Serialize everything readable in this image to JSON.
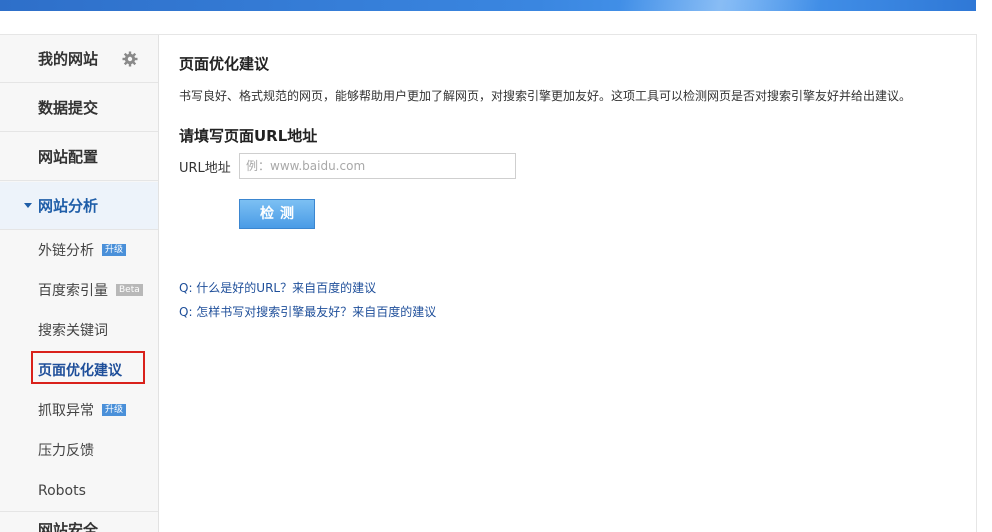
{
  "sidebar": {
    "top_items": [
      {
        "label": "我的网站"
      },
      {
        "label": "数据提交"
      },
      {
        "label": "网站配置"
      },
      {
        "label": "网站分析"
      }
    ],
    "sub_items": [
      {
        "label": "外链分析",
        "badge": "升级"
      },
      {
        "label": "百度索引量",
        "badge": "Beta"
      },
      {
        "label": "搜索关键词"
      },
      {
        "label": "页面优化建议"
      },
      {
        "label": "抓取异常",
        "badge": "升级"
      },
      {
        "label": "压力反馈"
      },
      {
        "label": "Robots"
      }
    ],
    "bottom_label": "网站安全"
  },
  "main": {
    "title": "页面优化建议",
    "description": "书写良好、格式规范的网页，能够帮助用户更加了解网页，对搜索引擎更加友好。这项工具可以检测网页是否对搜索引擎友好并给出建议。",
    "form_title": "请填写页面URL地址",
    "url_label": "URL地址",
    "url_placeholder": "例：www.baidu.com",
    "url_value": "",
    "check_button": "检测",
    "faq": [
      {
        "label": "Q: 什么是好的URL？来自百度的建议"
      },
      {
        "label": "Q: 怎样书写对搜索引擎最友好？来自百度的建议"
      }
    ]
  },
  "icons": {
    "settings": "gear-icon",
    "expand": "caret-down-icon"
  },
  "colors": {
    "accent": "#1f5ea8",
    "highlight": "#d9211b",
    "button": "#4a9be6",
    "link": "#1f4f9a"
  }
}
